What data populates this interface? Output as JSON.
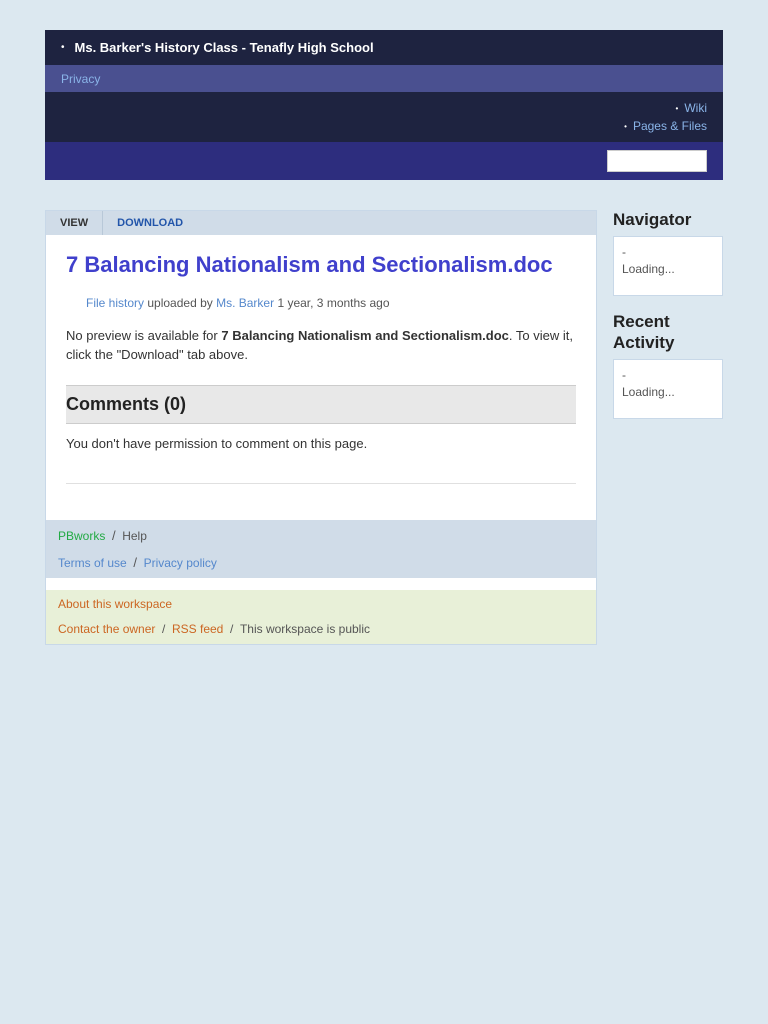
{
  "topBar1": {
    "bullet": "•",
    "title": "Ms. Barker's History Class - Tenafly High School"
  },
  "topBar2": {
    "linkText": "Privacy"
  },
  "topBar3": {
    "navItems": [
      {
        "bullet": "•",
        "label": "Wiki"
      },
      {
        "bullet": "•",
        "label": "Pages & Files"
      }
    ]
  },
  "topBar4": {
    "searchPlaceholder": ""
  },
  "tabs": {
    "view": "VIEW",
    "download": "DOWNLOAD"
  },
  "fileTitle": "7 Balancing Nationalism and Sectionalism.doc",
  "fileHistory": {
    "fileHistoryLabel": "File history",
    "uploadedBy": "uploaded by",
    "author": "Ms. Barker",
    "timeAgo": "1 year, 3 months ago"
  },
  "noPreview": {
    "prefix": "No preview is available for ",
    "filename": "7 Balancing Nationalism and Sectionalism.doc",
    "suffix": ". To view it, click the \"Download\" tab above."
  },
  "comments": {
    "heading": "Comments (0)",
    "body": "You don't have permission to comment on this page."
  },
  "footerLinks": {
    "pbworks": "PBworks",
    "separator1": "/",
    "help": "Help",
    "termsOfUse": "Terms of use",
    "separator2": "/",
    "privacyPolicy": "Privacy policy"
  },
  "footerAbout": {
    "aboutWorkspace": "About this workspace",
    "contactOwner": "Contact the owner",
    "separator1": "/",
    "rssFeed": "RSS feed",
    "separator2": "/",
    "publicNote": "This workspace is public"
  },
  "sidebar": {
    "navigatorTitle": "Navigator",
    "navigatorDash": "-",
    "navigatorLoading": "Loading...",
    "recentActivityTitle": "Recent Activity",
    "recentActivityDash": "-",
    "recentActivityLoading": "Loading..."
  }
}
